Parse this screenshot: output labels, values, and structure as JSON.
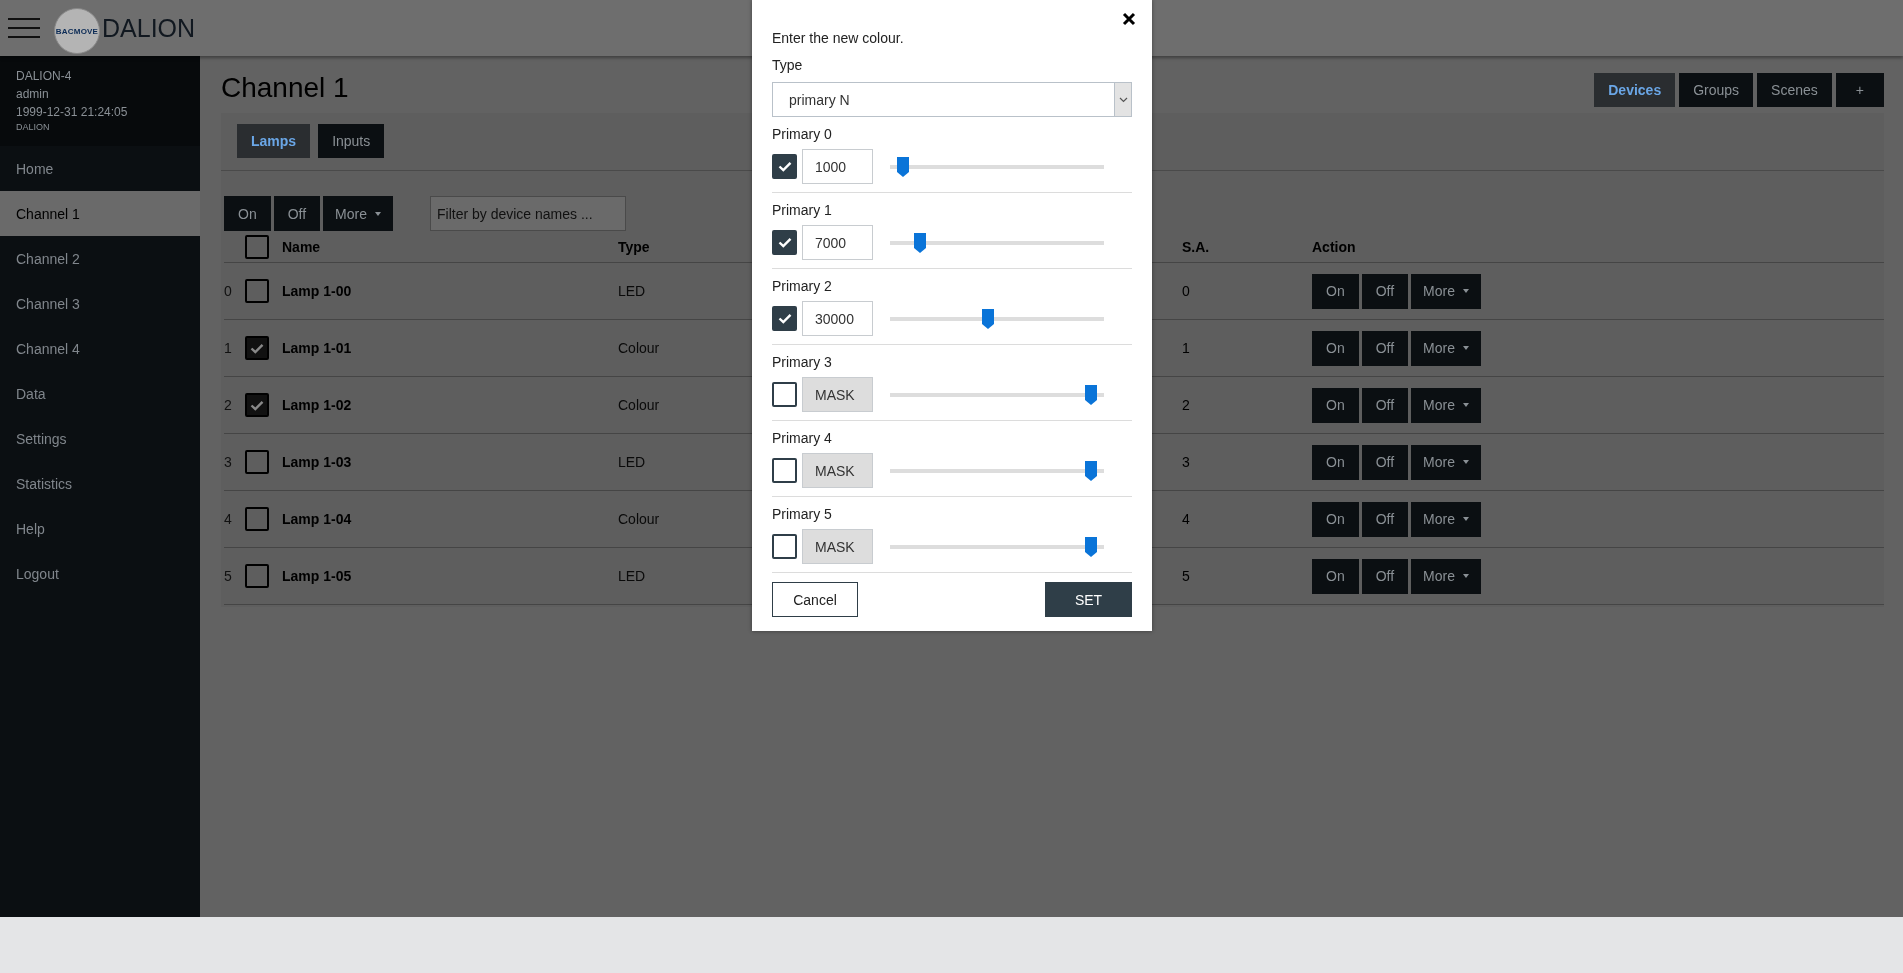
{
  "header": {
    "logo_text": "BACMOVE",
    "brand": "DALION"
  },
  "sidebar": {
    "info": [
      "DALION-4",
      "admin",
      "1999-12-31 21:24:05"
    ],
    "info_small": "DALION",
    "items": [
      {
        "label": "Home",
        "selected": false
      },
      {
        "label": "Channel 1",
        "selected": true
      },
      {
        "label": "Channel 2",
        "selected": false
      },
      {
        "label": "Channel 3",
        "selected": false
      },
      {
        "label": "Channel 4",
        "selected": false
      },
      {
        "label": "Data",
        "selected": false
      },
      {
        "label": "Settings",
        "selected": false
      },
      {
        "label": "Statistics",
        "selected": false
      },
      {
        "label": "Help",
        "selected": false
      },
      {
        "label": "Logout",
        "selected": false
      }
    ]
  },
  "page": {
    "title": "Channel 1",
    "view_tabs": [
      {
        "label": "Devices",
        "selected": true
      },
      {
        "label": "Groups",
        "selected": false
      },
      {
        "label": "Scenes",
        "selected": false
      },
      {
        "label": "+",
        "selected": false
      }
    ],
    "tabs": [
      {
        "label": "Lamps",
        "selected": true
      },
      {
        "label": "Inputs",
        "selected": false
      }
    ]
  },
  "toolbar": {
    "buttons": [
      "On",
      "Off",
      "More"
    ],
    "filter": {
      "placeholder": "Filter by device names ..."
    }
  },
  "table": {
    "columns": [
      "Name",
      "Type",
      "S.A.",
      "Action"
    ],
    "header_checked": false,
    "rows": [
      {
        "index": "0",
        "checked": false,
        "name": "Lamp 1-00",
        "type": "LED",
        "sa": "0",
        "actions": [
          "On",
          "Off",
          "More"
        ]
      },
      {
        "index": "1",
        "checked": true,
        "name": "Lamp 1-01",
        "type": "Colour",
        "sa": "1",
        "actions": [
          "On",
          "Off",
          "More"
        ]
      },
      {
        "index": "2",
        "checked": true,
        "name": "Lamp 1-02",
        "type": "Colour",
        "sa": "2",
        "actions": [
          "On",
          "Off",
          "More"
        ]
      },
      {
        "index": "3",
        "checked": false,
        "name": "Lamp 1-03",
        "type": "LED",
        "sa": "3",
        "actions": [
          "On",
          "Off",
          "More"
        ]
      },
      {
        "index": "4",
        "checked": false,
        "name": "Lamp 1-04",
        "type": "Colour",
        "sa": "4",
        "actions": [
          "On",
          "Off",
          "More"
        ]
      },
      {
        "index": "5",
        "checked": false,
        "name": "Lamp 1-05",
        "type": "LED",
        "sa": "5",
        "actions": [
          "On",
          "Off",
          "More"
        ]
      }
    ]
  },
  "dialog": {
    "prompt": "Enter the new colour.",
    "type_label": "Type",
    "type_value": "primary N",
    "primaries": [
      {
        "label": "Primary 0",
        "checked": true,
        "value": "1000",
        "level": 0.06
      },
      {
        "label": "Primary 1",
        "checked": true,
        "value": "7000",
        "level": 0.14
      },
      {
        "label": "Primary 2",
        "checked": true,
        "value": "30000",
        "level": 0.46
      },
      {
        "label": "Primary 3",
        "checked": false,
        "value": "MASK",
        "level": 0.94
      },
      {
        "label": "Primary 4",
        "checked": false,
        "value": "MASK",
        "level": 0.94
      },
      {
        "label": "Primary 5",
        "checked": false,
        "value": "MASK",
        "level": 0.94
      }
    ],
    "cancel": "Cancel",
    "set": "SET"
  }
}
